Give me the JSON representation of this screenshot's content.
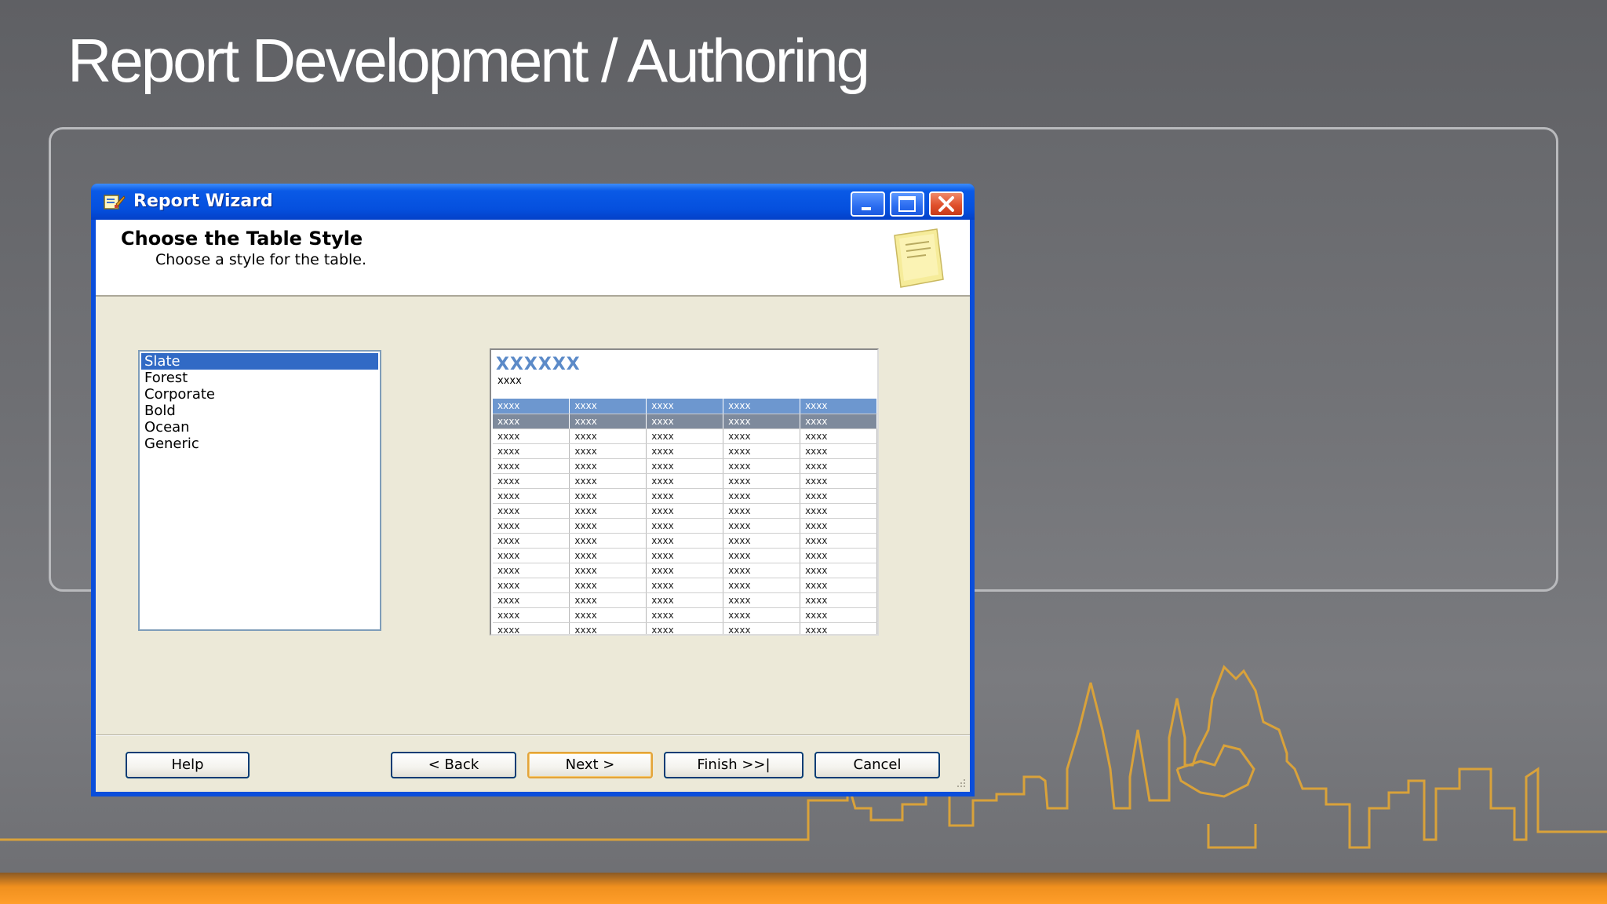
{
  "slide": {
    "title": "Report Development / Authoring"
  },
  "window": {
    "title": "Report Wizard",
    "heading": "Choose the Table Style",
    "subheading": "Choose a style for the table."
  },
  "styles": {
    "items": [
      "Slate",
      "Forest",
      "Corporate",
      "Bold",
      "Ocean",
      "Generic"
    ],
    "selected": "Slate"
  },
  "preview": {
    "title": "XXXXXX",
    "subtitle": "xxxx",
    "header_row": [
      "xxxx",
      "xxxx",
      "xxxx",
      "xxxx",
      "xxxx"
    ],
    "group_row": [
      "xxxx",
      "xxxx",
      "xxxx",
      "xxxx",
      "xxxx"
    ],
    "detail_row": [
      "xxxx",
      "xxxx",
      "xxxx",
      "xxxx",
      "xxxx"
    ],
    "detail_row_count": 15
  },
  "buttons": {
    "help": "Help",
    "back": "< Back",
    "next": "Next >",
    "finish": "Finish >>|",
    "cancel": "Cancel"
  },
  "colors": {
    "titlebar": "#0550de",
    "selection": "#316ac5",
    "preview_header": "#6d97cf",
    "preview_group": "#7e8a9c",
    "accent_orange": "#f0a020"
  }
}
